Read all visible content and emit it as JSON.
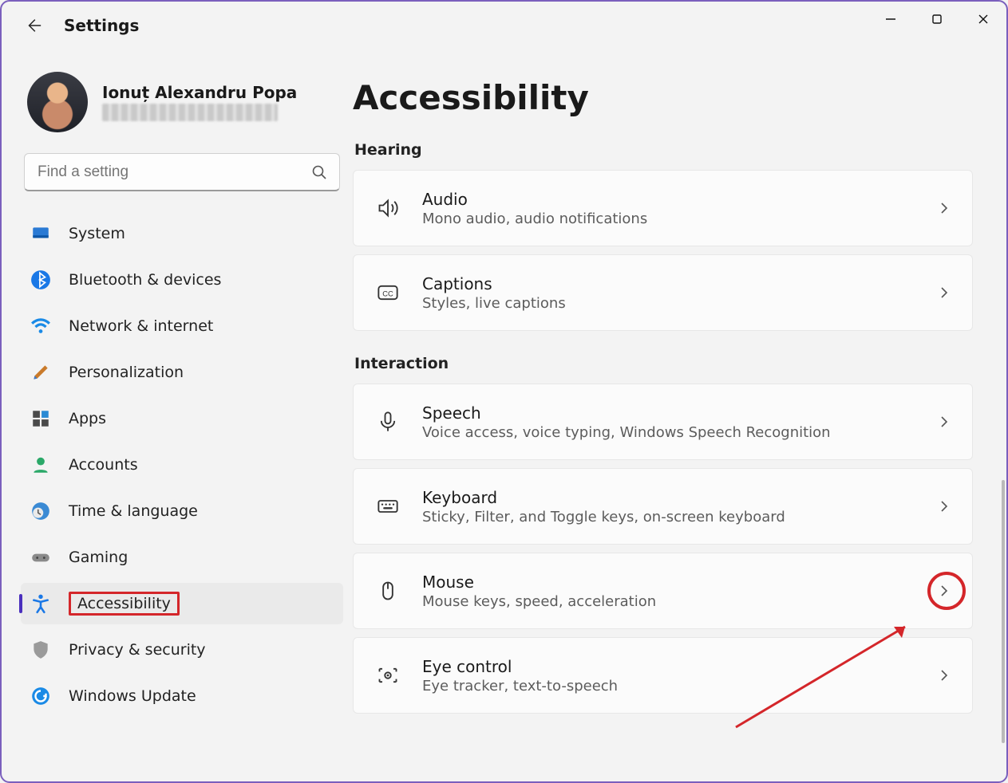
{
  "app": {
    "title": "Settings"
  },
  "profile": {
    "name": "Ionuț Alexandru Popa"
  },
  "search": {
    "placeholder": "Find a setting"
  },
  "nav": {
    "items": [
      {
        "id": "system",
        "label": "System"
      },
      {
        "id": "bluetooth",
        "label": "Bluetooth & devices"
      },
      {
        "id": "network",
        "label": "Network & internet"
      },
      {
        "id": "personalization",
        "label": "Personalization"
      },
      {
        "id": "apps",
        "label": "Apps"
      },
      {
        "id": "accounts",
        "label": "Accounts"
      },
      {
        "id": "time",
        "label": "Time & language"
      },
      {
        "id": "gaming",
        "label": "Gaming"
      },
      {
        "id": "accessibility",
        "label": "Accessibility"
      },
      {
        "id": "privacy",
        "label": "Privacy & security"
      },
      {
        "id": "update",
        "label": "Windows Update"
      }
    ]
  },
  "page": {
    "title": "Accessibility",
    "sections": {
      "hearing": {
        "title": "Hearing",
        "audio": {
          "title": "Audio",
          "sub": "Mono audio, audio notifications"
        },
        "captions": {
          "title": "Captions",
          "sub": "Styles, live captions"
        }
      },
      "interaction": {
        "title": "Interaction",
        "speech": {
          "title": "Speech",
          "sub": "Voice access, voice typing, Windows Speech Recognition"
        },
        "keyboard": {
          "title": "Keyboard",
          "sub": "Sticky, Filter, and Toggle keys, on-screen keyboard"
        },
        "mouse": {
          "title": "Mouse",
          "sub": "Mouse keys, speed, acceleration"
        },
        "eye": {
          "title": "Eye control",
          "sub": "Eye tracker, text-to-speech"
        }
      }
    }
  }
}
